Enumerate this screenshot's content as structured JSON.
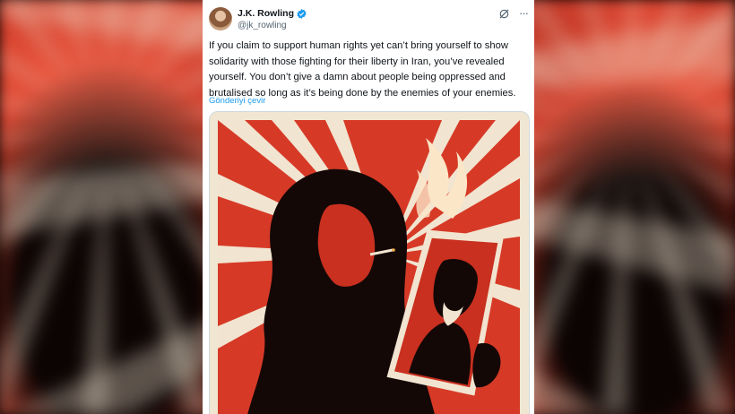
{
  "tweet": {
    "author_name": "J.K. Rowling",
    "handle": "@jk_rowling",
    "text": "If you claim to support human rights yet can’t bring yourself to show solidarity with those fighting for their liberty in Iran, you’ve revealed yourself. You don’t give a damn about people being oppressed and brutalised so long as it’s being done by the enemies of your enemies.",
    "translate_label": "Gönderiyi çevir",
    "more_glyph": "···"
  },
  "icons": {
    "verified": "verified-badge-icon",
    "grok": "grok-icon",
    "more": "more-icon"
  },
  "colors": {
    "accent": "#1d9bf0",
    "text": "#0f1419",
    "muted": "#536471",
    "poster_red": "#d63a27",
    "poster_cream": "#f1e4d0"
  }
}
